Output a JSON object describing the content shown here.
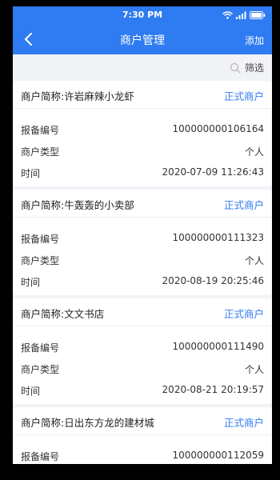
{
  "status_bar": {
    "time": "7:30 PM"
  },
  "nav": {
    "title": "商户管理",
    "add_label": "添加"
  },
  "filter": {
    "label": "筛选"
  },
  "colors": {
    "primary": "#2f7bf1",
    "background": "#f2f3f7"
  },
  "labels": {
    "report_no": "报备编号",
    "merchant_type": "商户类型",
    "time": "时间"
  },
  "merchants": [
    {
      "name": "商户简称:许岩麻辣小龙虾",
      "status": "正式商户",
      "report_no": "100000000106164",
      "merchant_type": "个人",
      "time": "2020-07-09 11:26:43"
    },
    {
      "name": "商户简称:牛轰轰的小卖部",
      "status": "正式商户",
      "report_no": "100000000111323",
      "merchant_type": "个人",
      "time": "2020-08-19 20:25:46"
    },
    {
      "name": "商户简称:文文书店",
      "status": "正式商户",
      "report_no": "100000000111490",
      "merchant_type": "个人",
      "time": "2020-08-21 20:19:57"
    },
    {
      "name": "商户简称:日出东方龙的建材城",
      "status": "正式商户",
      "report_no": "100000000112059"
    }
  ]
}
